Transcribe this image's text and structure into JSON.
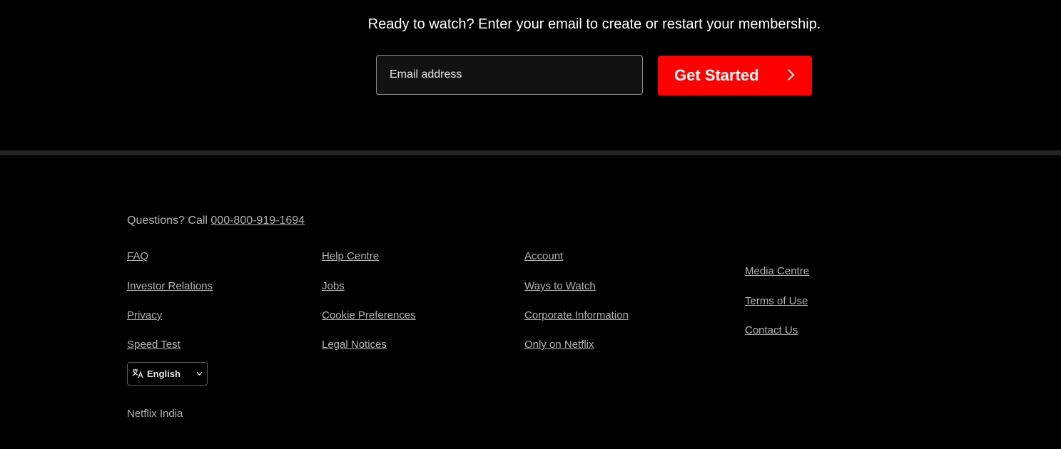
{
  "cta": {
    "heading": "Ready to watch? Enter your email to create or restart your membership.",
    "email_placeholder": "Email address",
    "button_label": "Get Started",
    "button_icon": "chevron-right-icon"
  },
  "footer": {
    "questions_text": "Questions? Call ",
    "phone": "000-800-919-1694",
    "columns": [
      {
        "links": [
          "FAQ",
          "Investor Relations",
          "Privacy",
          "Speed Test"
        ]
      },
      {
        "links": [
          "Help Centre",
          "Jobs",
          "Cookie Preferences",
          "Legal Notices"
        ]
      },
      {
        "links": [
          "Account",
          "Ways to Watch",
          "Corporate Information",
          "Only on Netflix"
        ]
      },
      {
        "links": [
          "Media Centre",
          "Terms of Use",
          "Contact Us"
        ]
      }
    ],
    "language": {
      "icon": "language-icon",
      "selected": "English"
    },
    "country": "Netflix India"
  },
  "colors": {
    "background": "#000000",
    "accent": "#ff0000",
    "divider": "#232323",
    "footer_text": "#b3b3b3"
  }
}
